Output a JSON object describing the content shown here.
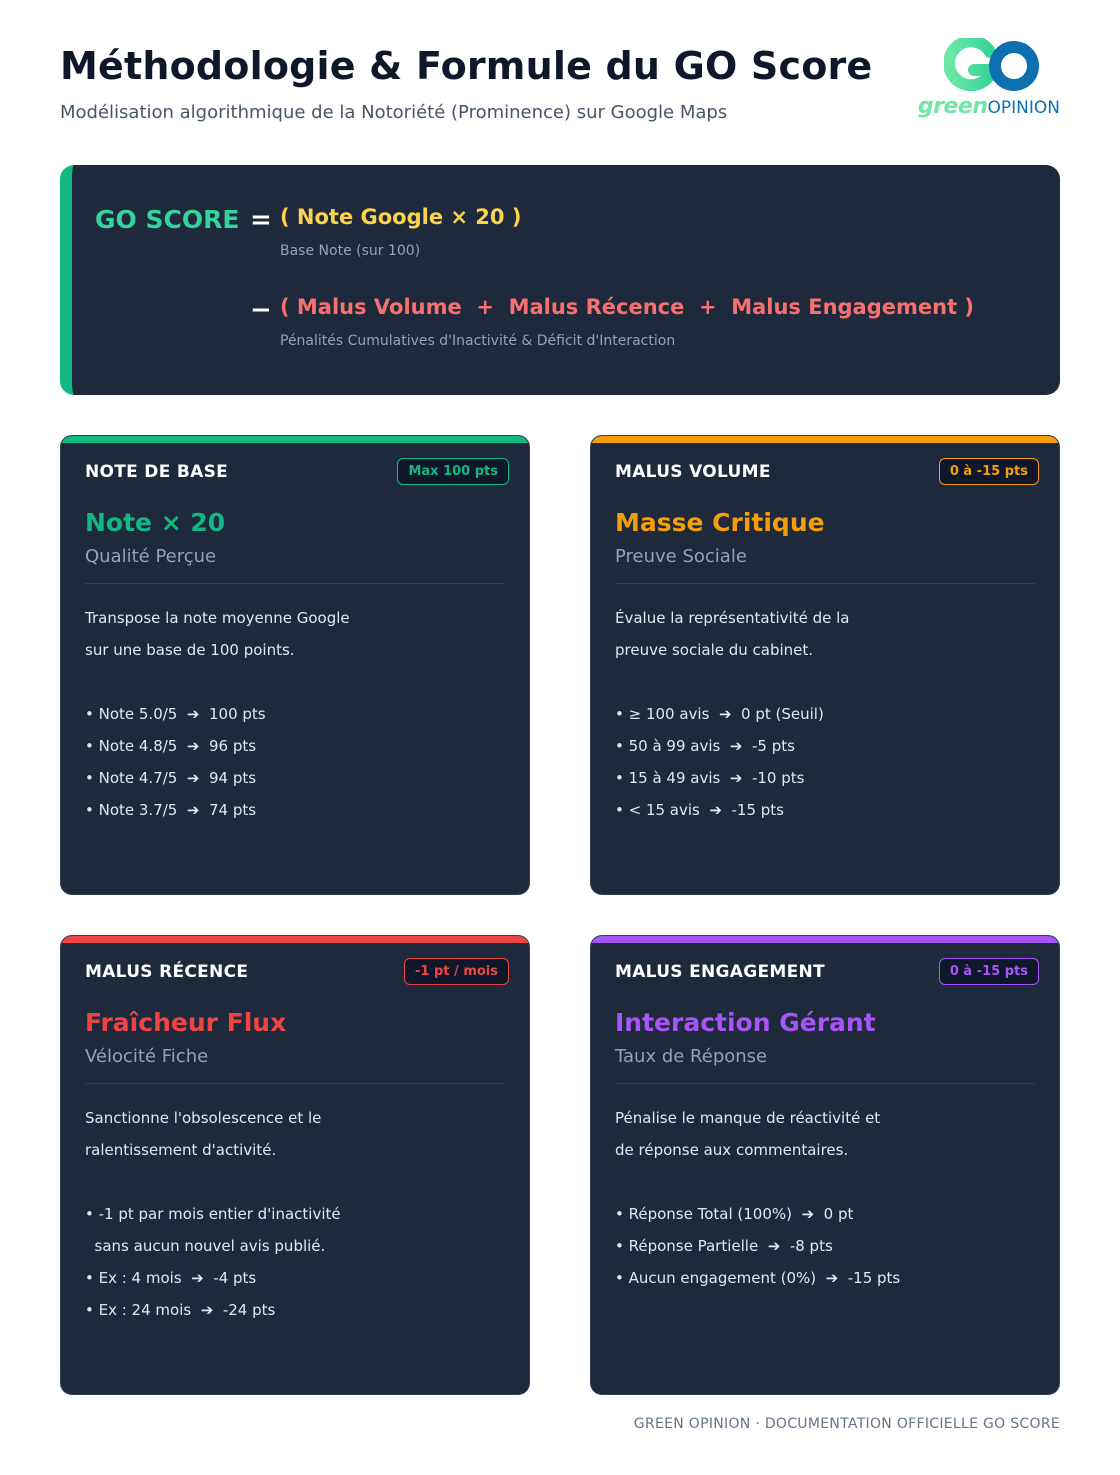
{
  "header": {
    "title": "Méthodologie & Formule du GO Score",
    "subtitle": "Modélisation algorithmique de la Notoriété (Prominence) sur Google Maps"
  },
  "logo": {
    "mark": "GO",
    "green": "green",
    "opinion": "OPINION"
  },
  "formula": {
    "label": "GO SCORE",
    "equals": "=",
    "minus": "−",
    "base": "( Note Google × 20 )",
    "base_note": "Base Note (sur 100)",
    "malus": "( Malus Volume  +  Malus Récence  +  Malus Engagement )",
    "malus_note": "Pénalités Cumulatives d'Inactivité & Déficit d'Interaction"
  },
  "colors": {
    "green": "#10b981",
    "orange": "#f59e0b",
    "red": "#ef4444",
    "purple": "#a855f7",
    "dark": "#1e293b"
  },
  "cards": {
    "base": {
      "head": "NOTE DE BASE",
      "badge": "Max 100 pts",
      "big": "Note × 20",
      "sub": "Qualité Perçue",
      "desc": [
        "Transpose la note moyenne Google",
        "sur une base de 100 points."
      ],
      "items": [
        "• Note 5.0/5  ➔  100 pts",
        "• Note 4.8/5  ➔  96 pts",
        "• Note 4.7/5  ➔  94 pts",
        "• Note 3.7/5  ➔  74 pts"
      ]
    },
    "volume": {
      "head": "MALUS VOLUME",
      "badge": "0 à -15 pts",
      "big": "Masse Critique",
      "sub": "Preuve Sociale",
      "desc": [
        "Évalue la représentativité de la",
        "preuve sociale du cabinet."
      ],
      "items": [
        "• ≥ 100 avis  ➔  0 pt (Seuil)",
        "• 50 à 99 avis  ➔  -5 pts",
        "• 15 à 49 avis  ➔  -10 pts",
        "• < 15 avis  ➔  -15 pts"
      ]
    },
    "recence": {
      "head": "MALUS RÉCENCE",
      "badge": "-1 pt / mois",
      "big": "Fraîcheur Flux",
      "sub": "Vélocité Fiche",
      "desc": [
        "Sanctionne l'obsolescence et le",
        "ralentissement d'activité."
      ],
      "items": [
        "• -1 pt par mois entier d'inactivité",
        "  sans aucun nouvel avis publié.",
        "• Ex : 4 mois  ➔  -4 pts",
        "• Ex : 24 mois  ➔  -24 pts"
      ]
    },
    "engagement": {
      "head": "MALUS ENGAGEMENT",
      "badge": "0 à -15 pts",
      "big": "Interaction Gérant",
      "sub": "Taux de Réponse",
      "desc": [
        "Pénalise le manque de réactivité et",
        "de réponse aux commentaires."
      ],
      "items": [
        "• Réponse Total (100%)  ➔  0 pt",
        "• Réponse Partielle  ➔  -8 pts",
        "• Aucun engagement (0%)  ➔  -15 pts"
      ]
    }
  },
  "footer": "GREEN OPINION · DOCUMENTATION OFFICIELLE GO SCORE"
}
